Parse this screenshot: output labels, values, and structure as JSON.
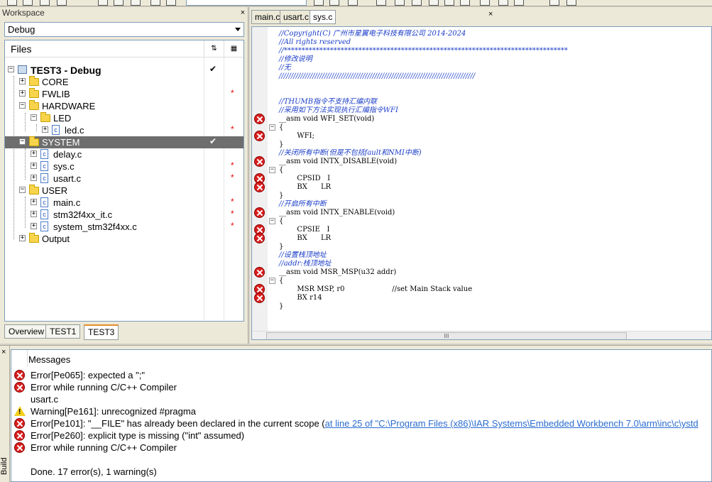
{
  "workspace": {
    "title": "Workspace",
    "close_glyph": "×",
    "config": "Debug",
    "files_label": "Files",
    "tabs": [
      "Overview",
      "TEST1",
      "TEST3"
    ],
    "tree": [
      {
        "label": "TEST3 - Debug",
        "check": "✔",
        "star": ""
      },
      {
        "label": "CORE",
        "check": "",
        "star": ""
      },
      {
        "label": "FWLIB",
        "check": "",
        "star": "*"
      },
      {
        "label": "HARDWARE",
        "check": "",
        "star": ""
      },
      {
        "label": "LED",
        "check": "",
        "star": ""
      },
      {
        "label": "led.c",
        "check": "",
        "star": "*"
      },
      {
        "label": "SYSTEM",
        "check": "✔",
        "star": ""
      },
      {
        "label": "delay.c",
        "check": "",
        "star": ""
      },
      {
        "label": "sys.c",
        "check": "",
        "star": "*"
      },
      {
        "label": "usart.c",
        "check": "",
        "star": "*"
      },
      {
        "label": "USER",
        "check": "",
        "star": ""
      },
      {
        "label": "main.c",
        "check": "",
        "star": "*"
      },
      {
        "label": "stm32f4xx_it.c",
        "check": "",
        "star": "*"
      },
      {
        "label": "system_stm32f4xx.c",
        "check": "",
        "star": "*"
      },
      {
        "label": "Output",
        "check": "",
        "star": ""
      }
    ]
  },
  "editor": {
    "tabs": [
      "main.c",
      "usart.c",
      "sys.c"
    ],
    "active_tab": "sys.c",
    "close_glyph": "×",
    "hscroll_grip": "III",
    "code": [
      "//Copyright(C) 广州市星翼电子科技有限公司 2014-2024",
      "//All rights reserved",
      "//********************************************************************************",
      "//修改说明",
      "//无",
      "//////////////////////////////////////////////////////////////////////////////////",
      "",
      "",
      "//THUMB指令不支持汇编内联",
      "//采用如下方法实现执行汇编指令WFI",
      "__asm void WFI_SET(void)",
      "{",
      "        WFI;",
      "}",
      "//关闭所有中断(但是不包括fault和NMI中断)",
      "__asm void INTX_DISABLE(void)",
      "{",
      "        CPSID   I",
      "        BX      LR",
      "}",
      "//开启所有中断",
      "__asm void INTX_ENABLE(void)",
      "{",
      "        CPSIE   I",
      "        BX      LR",
      "}",
      "//设置栈顶地址",
      "//addr:栈顶地址",
      "__asm void MSR_MSP(u32 addr)",
      "{",
      "        MSR MSP, r0                     //set Main Stack value",
      "        BX r14",
      "}"
    ]
  },
  "messages": {
    "header": "Messages",
    "side_label": "Build",
    "close_glyph": "×",
    "rows": [
      {
        "type": "error",
        "text": "Error[Pe065]: expected a \";\"",
        "link": ""
      },
      {
        "type": "error",
        "text": "Error while running C/C++ Compiler",
        "link": ""
      },
      {
        "type": "none",
        "text": "usart.c",
        "link": ""
      },
      {
        "type": "warning",
        "text": "Warning[Pe161]: unrecognized #pragma",
        "link": ""
      },
      {
        "type": "error",
        "text": "Error[Pe101]: \"__FILE\" has already been declared in the current scope (",
        "link": "at line 25 of \"C:\\Program Files (x86)\\IAR Systems\\Embedded Workbench 7.0\\arm\\inc\\c\\ystd"
      },
      {
        "type": "error",
        "text": "Error[Pe260]: explicit type is missing (\"int\" assumed)",
        "link": ""
      },
      {
        "type": "error",
        "text": "Error while running C/C++ Compiler",
        "link": ""
      },
      {
        "type": "none",
        "text": "",
        "link": ""
      },
      {
        "type": "none",
        "text": "Done. 17 error(s), 1 warning(s)",
        "link": ""
      }
    ]
  }
}
